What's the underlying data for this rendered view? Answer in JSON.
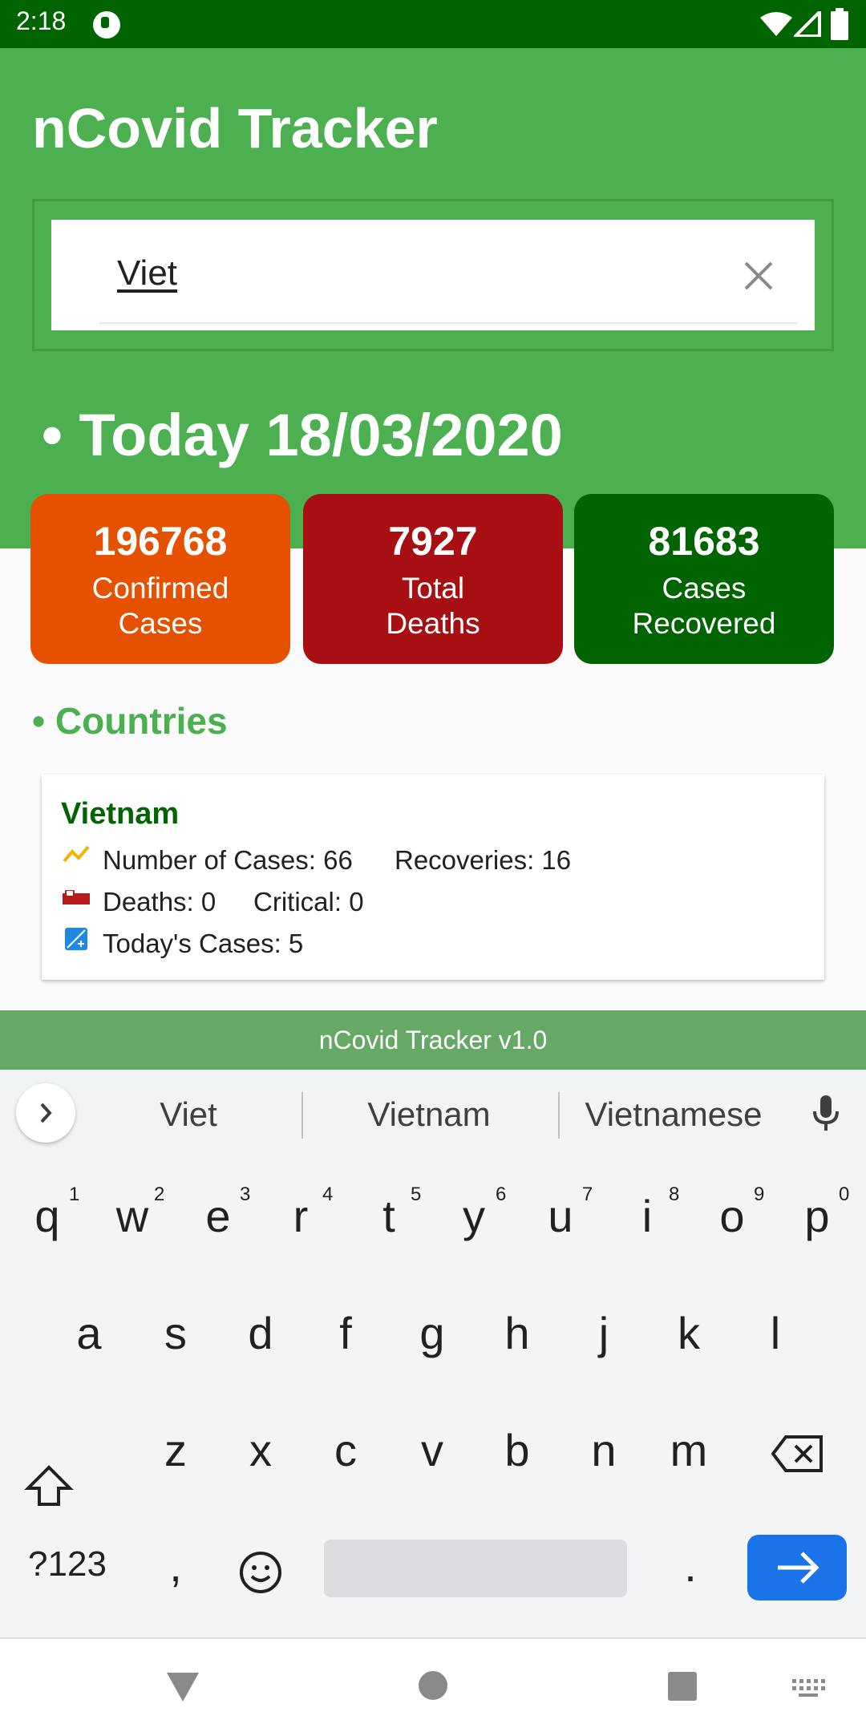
{
  "status_bar": {
    "time": "2:18"
  },
  "app": {
    "title": "nCovid Tracker"
  },
  "search": {
    "value": "Viet"
  },
  "today": {
    "label": "• Today 18/03/2020"
  },
  "stats": [
    {
      "number": "196768",
      "label": "Confirmed\nCases",
      "color": "#e65100"
    },
    {
      "number": "7927",
      "label": "Total\nDeaths",
      "color": "#a80f12"
    },
    {
      "number": "81683",
      "label": "Cases\nRecovered",
      "color": "#006400"
    }
  ],
  "countries": {
    "title": "• Countries",
    "items": [
      {
        "name": "Vietnam",
        "cases_label": "Number of Cases:",
        "cases": "66",
        "recoveries_label": "Recoveries:",
        "recoveries": "16",
        "deaths_label": "Deaths:",
        "deaths": "0",
        "critical_label": "Critical:",
        "critical": "0",
        "today_label": "Today's Cases:",
        "today_cases": "5"
      }
    ]
  },
  "footer": {
    "text": "nCovid Tracker v1.0"
  },
  "keyboard": {
    "suggestions": [
      "Viet",
      "Vietnam",
      "Vietnamese"
    ],
    "row1": [
      "q",
      "w",
      "e",
      "r",
      "t",
      "y",
      "u",
      "i",
      "o",
      "p"
    ],
    "row1_hints": [
      "1",
      "2",
      "3",
      "4",
      "5",
      "6",
      "7",
      "8",
      "9",
      "0"
    ],
    "row2": [
      "a",
      "s",
      "d",
      "f",
      "g",
      "h",
      "j",
      "k",
      "l"
    ],
    "row3": [
      "z",
      "x",
      "c",
      "v",
      "b",
      "n",
      "m"
    ],
    "symbols_label": "?123",
    "comma": ",",
    "period": "."
  },
  "colors": {
    "header": "#4caf50",
    "status_bar": "#006400",
    "accent": "#1a73e8"
  }
}
